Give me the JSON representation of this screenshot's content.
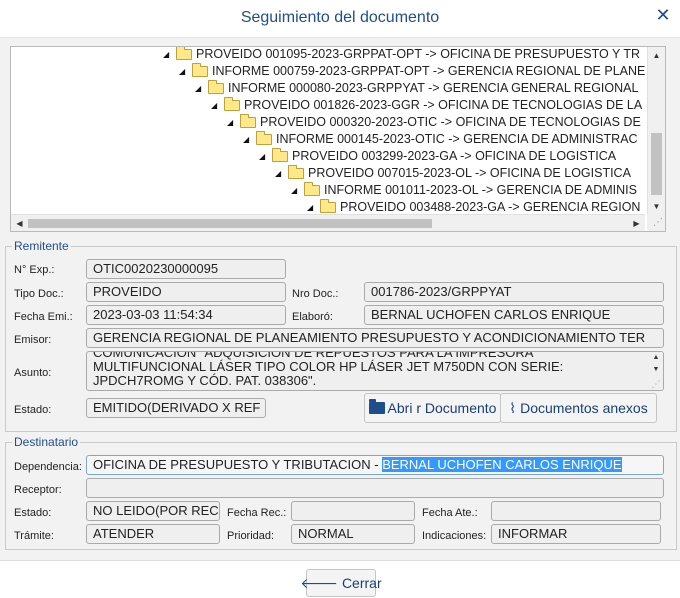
{
  "dialog": {
    "title": "Seguimiento del documento"
  },
  "tree": {
    "items": [
      "PROVEIDO 001095-2023-GRPPAT-OPT -> OFICINA DE PRESUPUESTO Y TR",
      "INFORME 000759-2023-GRPPAT-OPT -> GERENCIA REGIONAL DE PLANE",
      "INFORME 000080-2023-GRPPYAT -> GERENCIA GENERAL REGIONAL",
      "PROVEIDO 001826-2023-GGR -> OFICINA DE TECNOLOGIAS DE LA",
      "PROVEIDO 000320-2023-OTIC -> OFICINA DE TECNOLOGIAS DE",
      "INFORME 000145-2023-OTIC -> GERENCIA DE ADMINISTRAC",
      "PROVEIDO 003299-2023-GA -> OFICINA DE LOGISTICA",
      "PROVEIDO 007015-2023-OL -> OFICINA DE LOGISTICA",
      "INFORME 001011-2023-OL -> GERENCIA DE ADMINIS",
      "PROVEIDO 003488-2023-GA -> GERENCIA REGION"
    ]
  },
  "remitente": {
    "legend": "Remitente",
    "nro_exp_label": "N° Exp.:",
    "nro_exp": "OTIC0020230000095",
    "tipo_doc_label": "Tipo Doc.:",
    "tipo_doc": "PROVEIDO",
    "nro_doc_label": "Nro Doc.:",
    "nro_doc": "001786-2023/GRPPYAT",
    "fecha_emi_label": "Fecha Emi.:",
    "fecha_emi": "2023-03-03 11:54:34",
    "elaboro_label": "Elaboró:",
    "elaboro": "BERNAL UCHOFEN CARLOS ENRIQUE",
    "emisor_label": "Emisor:",
    "emisor": "GERENCIA REGIONAL DE PLANEAMIENTO PRESUPUESTO Y ACONDICIONAMIENTO TER",
    "asunto_label": "Asunto:",
    "asunto_lines": [
      "COMUNICACIÓN \"ADQUISICIÓN DE REPUESTOS PARA LA IMPRESORA",
      "MULTIFUNCIONAL LÁSER TIPO COLOR HP LÁSER JET M750DN CON SERIE:",
      "JPDCH7ROMG Y CÓD. PAT. 038306\"."
    ],
    "estado_label": "Estado:",
    "estado": "EMITIDO(DERIVADO X REF",
    "abrir_documento": "Abri r Documento",
    "documentos_anexos": "Documentos anexos"
  },
  "destinatario": {
    "legend": "Destinatario",
    "dependencia_label": "Dependencia:",
    "dependencia_prefix": "OFICINA DE PRESUPUESTO Y TRIBUTACION - ",
    "dependencia_selected": "BERNAL UCHOFEN CARLOS ENRIQUE",
    "receptor_label": "Receptor:",
    "receptor": "",
    "estado_label": "Estado:",
    "estado": "NO LEIDO(POR REC",
    "fecha_rec_label": "Fecha Rec.:",
    "fecha_rec": "",
    "fecha_ate_label": "Fecha Ate.:",
    "fecha_ate": "",
    "tramite_label": "Trámite:",
    "tramite": "ATENDER",
    "prioridad_label": "Prioridad:",
    "prioridad": "NORMAL",
    "indicaciones_label": "Indicaciones:",
    "indicaciones": "INFORMAR"
  },
  "footer": {
    "cerrar": "Cerrar"
  },
  "colors": {
    "title": "#1f4e8c",
    "selection": "#3399ff"
  }
}
